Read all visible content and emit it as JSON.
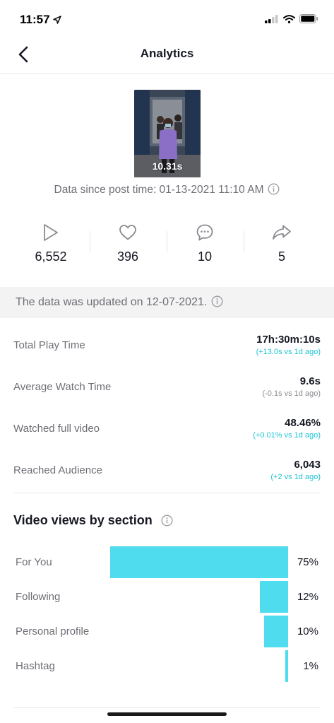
{
  "status_bar": {
    "time": "11:57"
  },
  "header": {
    "title": "Analytics"
  },
  "video": {
    "duration": "10.31s",
    "since_text": "Data since post time: 01-13-2021 11:10 AM"
  },
  "stats": [
    {
      "icon": "play-icon",
      "value": "6,552"
    },
    {
      "icon": "heart-icon",
      "value": "396"
    },
    {
      "icon": "comment-icon",
      "value": "10"
    },
    {
      "icon": "share-icon",
      "value": "5"
    }
  ],
  "banner": {
    "text": "The data was updated on 12-07-2021."
  },
  "metrics": [
    {
      "label": "Total Play Time",
      "value": "17h:30m:10s",
      "delta": "(+13.0s vs 1d ago)",
      "delta_color": "#20c3d6"
    },
    {
      "label": "Average Watch Time",
      "value": "9.6s",
      "delta": "(-0.1s vs 1d ago)",
      "delta_color": "#8a8b91"
    },
    {
      "label": "Watched full video",
      "value": "48.46%",
      "delta": "(+0.01% vs 1d ago)",
      "delta_color": "#20c3d6"
    },
    {
      "label": "Reached Audience",
      "value": "6,043",
      "delta": "(+2 vs 1d ago)",
      "delta_color": "#20c3d6"
    }
  ],
  "views_section": {
    "title": "Video views by section"
  },
  "chart_data": {
    "type": "bar",
    "orientation": "horizontal",
    "categories": [
      "For You",
      "Following",
      "Personal profile",
      "Hashtag"
    ],
    "values": [
      75,
      12,
      10,
      1
    ],
    "labels": [
      "75%",
      "12%",
      "10%",
      "1%"
    ],
    "bar_color": "#4fdcef"
  }
}
